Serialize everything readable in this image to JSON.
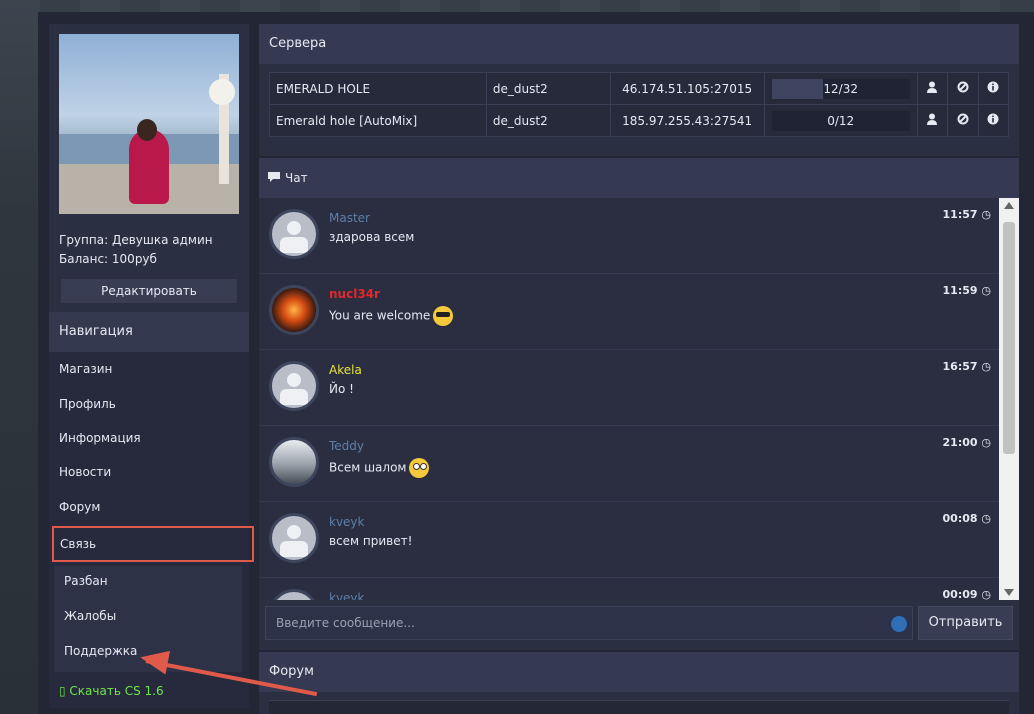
{
  "profile": {
    "group_line": "Группа: Девушка админ",
    "balance_line": "Баланс: 100руб",
    "edit_label": "Редактировать"
  },
  "nav": {
    "title": "Навигация",
    "items": [
      {
        "label": "Магазин"
      },
      {
        "label": "Профиль"
      },
      {
        "label": "Информация"
      },
      {
        "label": "Новости"
      },
      {
        "label": "Форум"
      },
      {
        "label": "Связь"
      }
    ],
    "sub_items": [
      {
        "label": "Разбан"
      },
      {
        "label": "Жалобы"
      },
      {
        "label": "Поддержка"
      }
    ],
    "download_label": "▯ Скачать CS 1.6"
  },
  "servers": {
    "title": "Сервера",
    "rows": [
      {
        "name": "EMERALD HOLE",
        "map": "de_dust2",
        "address": "46.174.51.105:27015",
        "players": "12/32",
        "fill_fraction": 0.375
      },
      {
        "name": "Emerald hole [AutoMix]",
        "map": "de_dust2",
        "address": "185.97.255.43:27541",
        "players": "0/12",
        "fill_fraction": 0
      }
    ]
  },
  "chat": {
    "title": "Чат",
    "messages": [
      {
        "name": "Master",
        "name_color": "#5d7fa8",
        "text": "здарова всем",
        "time": "11:57",
        "avatar": "default",
        "emoji": ""
      },
      {
        "name": "nucl34r",
        "name_color": "#e0282d",
        "text": "You are welcome",
        "time": "11:59",
        "avatar": "dragon",
        "emoji": "sunglasses"
      },
      {
        "name": "Akela",
        "name_color": "#e8e33a",
        "text": "Йо !",
        "time": "16:57",
        "avatar": "default",
        "emoji": ""
      },
      {
        "name": "Teddy",
        "name_color": "#5d7fa8",
        "text": "Всем шалом",
        "time": "21:00",
        "avatar": "teddy",
        "emoji": "rolling-eyes"
      },
      {
        "name": "kveyk",
        "name_color": "#5d7fa8",
        "text": "всем привет!",
        "time": "00:08",
        "avatar": "default",
        "emoji": ""
      },
      {
        "name": "kveyk",
        "name_color": "#5d7fa8",
        "text": "",
        "time": "00:09",
        "avatar": "default",
        "emoji": ""
      }
    ],
    "input_placeholder": "Введите сообщение...",
    "send_label": "Отправить"
  },
  "forum": {
    "title": "Форум"
  },
  "colors": {
    "highlight": "#e05a4a",
    "download_green": "#6ee64a",
    "panel_bg": "#2b2f42"
  }
}
